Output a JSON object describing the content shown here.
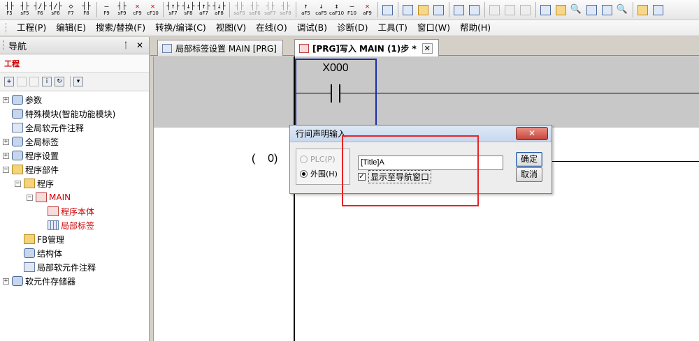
{
  "colors": {
    "highlight_red": "#e82424",
    "cursor_blue": "#1e2ea8",
    "tree_red": "#d00000"
  },
  "toolbar": {
    "ladder_keys": [
      {
        "sym": "┤├",
        "cap": "F5"
      },
      {
        "sym": "┤├",
        "cap": "sF5"
      },
      {
        "sym": "┤/├",
        "cap": "F6"
      },
      {
        "sym": "┤/├",
        "cap": "sF6"
      },
      {
        "sym": "◇",
        "cap": "F7"
      },
      {
        "sym": "┤├",
        "cap": "F8"
      }
    ],
    "ladder_keys_2": [
      {
        "sym": "—",
        "cap": "F9"
      },
      {
        "sym": "┤├",
        "cap": "sF9"
      },
      {
        "sym": "✕",
        "cap": "cF9",
        "red": true
      },
      {
        "sym": "✕",
        "cap": "cF10",
        "red": true
      }
    ],
    "ladder_keys_3": [
      {
        "sym": "┤↑├",
        "cap": "sF7"
      },
      {
        "sym": "┤↓├",
        "cap": "sF8"
      },
      {
        "sym": "┤↑├",
        "cap": "aF7"
      },
      {
        "sym": "┤↓├",
        "cap": "aF8"
      }
    ],
    "ladder_keys_dim": [
      {
        "sym": "┤├",
        "cap": "saF5"
      },
      {
        "sym": "┤├",
        "cap": "saF6"
      },
      {
        "sym": "┤├",
        "cap": "saF7"
      },
      {
        "sym": "┤├",
        "cap": "saF8"
      }
    ],
    "ladder_keys_4": [
      {
        "sym": "↑",
        "cap": "aF5"
      },
      {
        "sym": "↓",
        "cap": "caF5"
      },
      {
        "sym": "↕",
        "cap": "caF10"
      },
      {
        "sym": "—",
        "cap": "F10"
      },
      {
        "sym": "✕",
        "cap": "aF9",
        "red": true
      }
    ]
  },
  "menu": {
    "items": [
      "工程(P)",
      "编辑(E)",
      "搜索/替换(F)",
      "转换/编译(C)",
      "视图(V)",
      "在线(O)",
      "调试(B)",
      "诊断(D)",
      "工具(T)",
      "窗口(W)",
      "帮助(H)"
    ]
  },
  "nav": {
    "title": "导航",
    "pin": "ᛙ",
    "close": "✕",
    "project_label": "工程",
    "tree": [
      {
        "label": "参数",
        "level": 0,
        "exp": "+",
        "icon": "gear"
      },
      {
        "label": "特殊模块(智能功能模块)",
        "level": 0,
        "exp": "",
        "icon": "gear"
      },
      {
        "label": "全局软元件注释",
        "level": 0,
        "exp": "",
        "icon": "doc"
      },
      {
        "label": "全局标签",
        "level": 0,
        "exp": "+",
        "icon": "gear"
      },
      {
        "label": "程序设置",
        "level": 0,
        "exp": "+",
        "icon": "gear"
      },
      {
        "label": "程序部件",
        "level": 0,
        "exp": "−",
        "icon": "folder"
      },
      {
        "label": "程序",
        "level": 1,
        "exp": "−",
        "icon": "folder"
      },
      {
        "label": "MAIN",
        "level": 2,
        "exp": "−",
        "icon": "red",
        "red": true
      },
      {
        "label": "程序本体",
        "level": 3,
        "exp": "",
        "icon": "red",
        "red": true
      },
      {
        "label": "局部标签",
        "level": 3,
        "exp": "",
        "icon": "grid",
        "red": true
      },
      {
        "label": "FB管理",
        "level": 1,
        "exp": "",
        "icon": "folder"
      },
      {
        "label": "结构体",
        "level": 1,
        "exp": "",
        "icon": "gear"
      },
      {
        "label": "局部软元件注释",
        "level": 1,
        "exp": "",
        "icon": "doc"
      },
      {
        "label": "软元件存储器",
        "level": 0,
        "exp": "+",
        "icon": "gear"
      }
    ]
  },
  "tabs": [
    {
      "label": "局部标签设置 MAIN [PRG]",
      "active": false
    },
    {
      "label": "[PRG]写入 MAIN (1)步 *",
      "active": true
    }
  ],
  "tab_close": "✕",
  "ladder": {
    "device": "X000",
    "step_open": "(",
    "step_number": "0)"
  },
  "dialog": {
    "title": "行间声明输入",
    "close": "✕",
    "radio_plc": "PLC(P)",
    "radio_peripheral": "外围(H)",
    "input_value": "[Title]A",
    "checkbox_mark": "✓",
    "checkbox_label": "显示至导航窗口",
    "ok": "确定",
    "cancel": "取消"
  }
}
